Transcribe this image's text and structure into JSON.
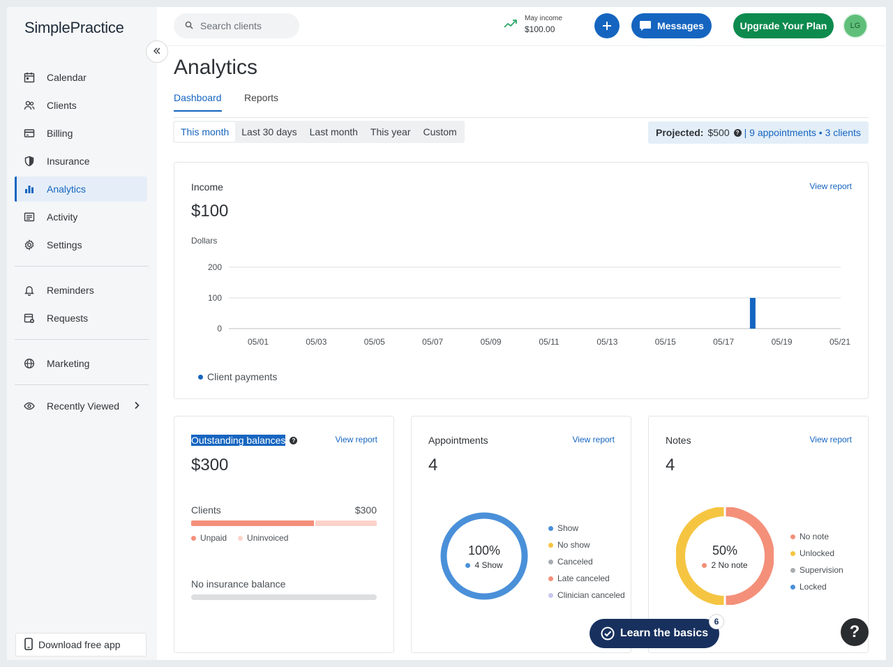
{
  "app": {
    "logo": "SimplePractice"
  },
  "sidebar": {
    "items": [
      {
        "label": "Calendar",
        "icon": "calendar-icon"
      },
      {
        "label": "Clients",
        "icon": "clients-icon"
      },
      {
        "label": "Billing",
        "icon": "billing-icon"
      },
      {
        "label": "Insurance",
        "icon": "shield-icon"
      },
      {
        "label": "Analytics",
        "icon": "bar-chart-icon",
        "active": true
      },
      {
        "label": "Activity",
        "icon": "activity-icon"
      },
      {
        "label": "Settings",
        "icon": "gear-icon"
      },
      {
        "label": "Reminders",
        "icon": "bell-icon"
      },
      {
        "label": "Requests",
        "icon": "calendar-request-icon"
      },
      {
        "label": "Marketing",
        "icon": "globe-icon"
      },
      {
        "label": "Recently Viewed",
        "icon": "eye-icon"
      }
    ],
    "download_label": "Download free app"
  },
  "header": {
    "search_placeholder": "Search clients",
    "income_label": "May income",
    "income_value": "$100.00",
    "messages_label": "Messages",
    "upgrade_label": "Upgrade Your Plan",
    "avatar_initials": "LG"
  },
  "page": {
    "title": "Analytics",
    "tabs": [
      "Dashboard",
      "Reports"
    ],
    "ranges": [
      "This month",
      "Last 30 days",
      "Last month",
      "This year",
      "Custom"
    ],
    "projected_label": "Projected:",
    "projected_value": "$500",
    "projected_detail": "| 9 appointments • 3 clients"
  },
  "income_card": {
    "title": "Income",
    "view_report": "View report",
    "value": "$100",
    "ylabel": "Dollars",
    "legend": "Client payments"
  },
  "chart_data": {
    "type": "bar",
    "x": [
      "05/01",
      "05/02",
      "05/03",
      "05/04",
      "05/05",
      "05/06",
      "05/07",
      "05/08",
      "05/09",
      "05/10",
      "05/11",
      "05/12",
      "05/13",
      "05/14",
      "05/15",
      "05/16",
      "05/17",
      "05/18",
      "05/19",
      "05/20",
      "05/21"
    ],
    "x_tick_labels": [
      "05/01",
      "05/03",
      "05/05",
      "05/07",
      "05/09",
      "05/11",
      "05/13",
      "05/15",
      "05/17",
      "05/19",
      "05/21"
    ],
    "series": [
      {
        "name": "Client payments",
        "values": [
          0,
          0,
          0,
          0,
          0,
          0,
          0,
          0,
          0,
          0,
          0,
          0,
          0,
          0,
          0,
          0,
          0,
          100,
          0,
          0,
          0
        ]
      }
    ],
    "ylabel": "Dollars",
    "ylim": [
      0,
      200
    ],
    "yticks": [
      0,
      100,
      200
    ],
    "grid": true,
    "legend_position": "bottom-left",
    "color": "#1565c0"
  },
  "outstanding": {
    "title": "Outstanding balances",
    "view_report": "View report",
    "value": "$300",
    "clients_label": "Clients",
    "clients_value": "$300",
    "unpaid_fraction": 0.67,
    "legend": [
      "Unpaid",
      "Uninvoiced"
    ],
    "no_insurance": "No insurance balance"
  },
  "appointments": {
    "title": "Appointments",
    "view_report": "View report",
    "value": "4",
    "donut_pct": "100%",
    "donut_sub": "4 Show",
    "legend": [
      {
        "label": "Show",
        "color": "#4a90d9"
      },
      {
        "label": "No show",
        "color": "#f5c542"
      },
      {
        "label": "Canceled",
        "color": "#a8acb0"
      },
      {
        "label": "Late canceled",
        "color": "#f4907a"
      },
      {
        "label": "Clinician canceled",
        "color": "#c9c7ef"
      }
    ]
  },
  "notes": {
    "title": "Notes",
    "view_report": "View report",
    "value": "4",
    "donut_pct": "50%",
    "donut_sub": "2 No note",
    "legend": [
      {
        "label": "No note",
        "color": "#f4907a"
      },
      {
        "label": "Unlocked",
        "color": "#f5c542"
      },
      {
        "label": "Supervision",
        "color": "#a8acb0"
      },
      {
        "label": "Locked",
        "color": "#4a90d9"
      }
    ]
  },
  "learn_basics": {
    "label": "Learn the basics",
    "badge": "6"
  },
  "help_label": "?"
}
